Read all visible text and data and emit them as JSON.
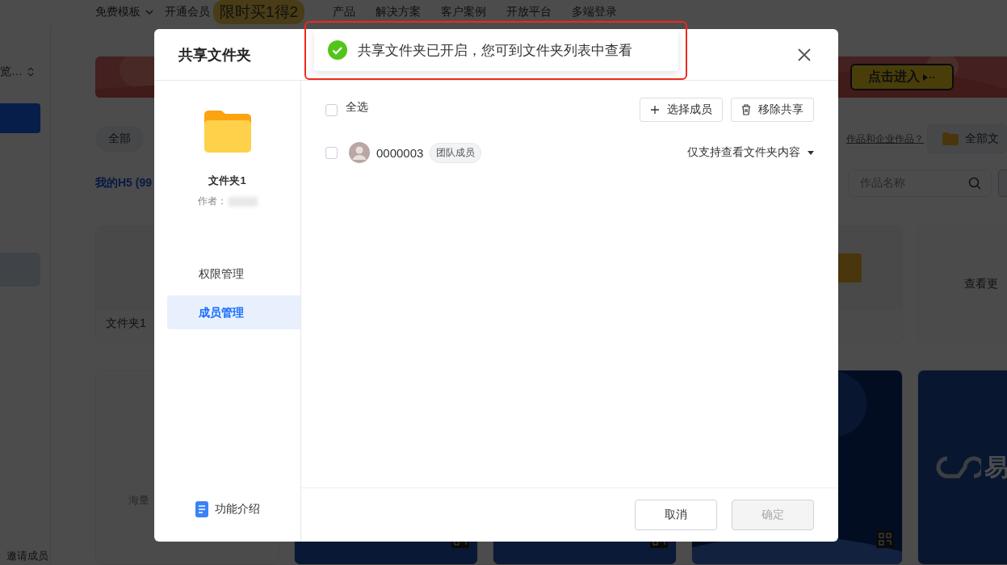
{
  "nav": {
    "templates": "免费模板",
    "membership": "开通会员",
    "promo": "限时买1得2",
    "links": [
      "产品",
      "解决方案",
      "客户案例",
      "开放平台",
      "多端登录"
    ]
  },
  "sidebar": {
    "switcher": "览…",
    "invite": "邀请成员"
  },
  "banner": {
    "button": "点击进入"
  },
  "filters": {
    "chip": "全部",
    "question": "作品和企业作品？",
    "folder_button": "全部文"
  },
  "section": {
    "title": "我的H5 (99",
    "search_placeholder": "作品名称"
  },
  "cards": {
    "folder": "文件夹1",
    "more": "查看更",
    "template": "海量",
    "logo": "易"
  },
  "dialog": {
    "title": "共享文件夹",
    "folder_name": "文件夹1",
    "author_label": "作者：",
    "menu": [
      {
        "label": "权限管理",
        "selected": false
      },
      {
        "label": "成员管理",
        "selected": true
      }
    ],
    "intro": "功能介绍",
    "select_all": {
      "label": "全选",
      "checked": false
    },
    "actions": [
      {
        "label": "选择成员",
        "kind": "add"
      },
      {
        "label": "移除共享",
        "kind": "delete"
      }
    ],
    "members": [
      {
        "id": "0000003",
        "tag": "团队成员",
        "permission": "仅支持查看文件夹内容",
        "checked": false
      }
    ],
    "buttons": [
      {
        "label": "取消",
        "disabled": false
      },
      {
        "label": "确定",
        "disabled": true
      }
    ]
  },
  "toast": {
    "message": "共享文件夹已开启，您可到文件夹列表中查看",
    "kind": "success"
  }
}
